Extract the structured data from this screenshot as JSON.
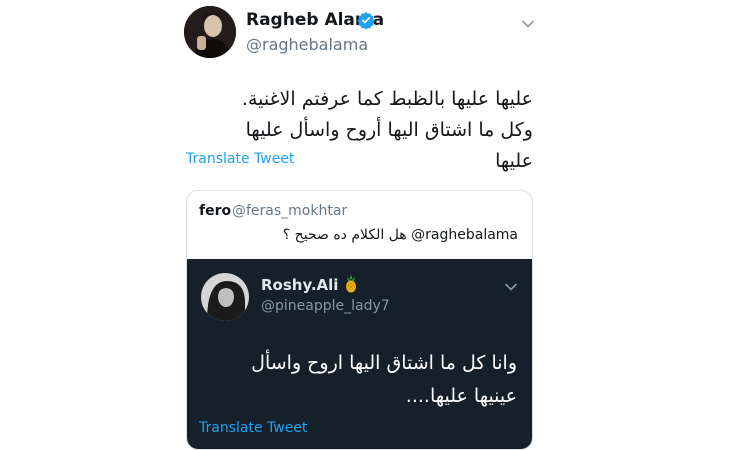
{
  "tweet": {
    "author_name": "Ragheb Alama",
    "author_handle": "@raghebalama",
    "verified_icon": "verified-badge-icon",
    "menu_icon": "chevron-down-icon",
    "text": "عليها عليها بالظبط كما عرفتم الاغنية. وكل ما اشتاق اليها أروح واسأل عليها عليها",
    "translate_label": "Translate Tweet"
  },
  "quoted_tweet": {
    "author_name": "fero",
    "author_handle": "@feras_mokhtar",
    "mention": "@raghebalama",
    "text": "هل الكلام ده صحيح ؟",
    "embedded_screenshot": {
      "author_name": "Roshy.Ali",
      "author_emoji_icon": "pineapple-icon",
      "author_handle": "@pineapple_lady7",
      "menu_icon": "chevron-down-icon",
      "text": "وانا كل ما اشتاق اليها اروح واسأل عينيها عليها....",
      "translate_label": "Translate Tweet"
    }
  },
  "colors": {
    "link": "#1da1f2",
    "verified": "#1da1f2",
    "embedded_background": "#15202b"
  }
}
